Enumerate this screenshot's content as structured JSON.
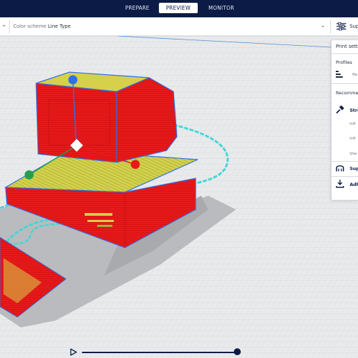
{
  "stages": {
    "prepare": "PREPARE",
    "preview": "PREVIEW",
    "monitor": "MONITOR",
    "active": "PREVIEW"
  },
  "toolbar": {
    "color_scheme_label": "Color scheme",
    "color_scheme_value": "Line Type",
    "settings_label": "Sup"
  },
  "print_panel": {
    "title": "Print settin",
    "profiles_label": "Profiles",
    "profile_value": "Re",
    "recommended_label": "Recomme",
    "strength_label": "Stre",
    "infill_density_label": "Infi",
    "infill_pattern_label": "Infi",
    "shell_label": "She",
    "support_label": "Sup",
    "adhesion_label": "Adh"
  },
  "colors": {
    "header_bg": "#0b1b46",
    "wall": "#e8191a",
    "infill": "#d6d04b",
    "skirt": "#45d6d6",
    "bed": "#e9eaec",
    "shadow": "#b5b6b9",
    "gizmo_blue": "#2f6fe8",
    "gizmo_green": "#20a050"
  },
  "icons": {
    "play": "play-icon",
    "settings": "sliders-icon",
    "strength": "hammer-icon",
    "support": "support-icon",
    "adhesion": "adhesion-icon",
    "profile": "profile-bars-icon"
  },
  "layer_slider": {
    "position_fraction": 1.0
  }
}
